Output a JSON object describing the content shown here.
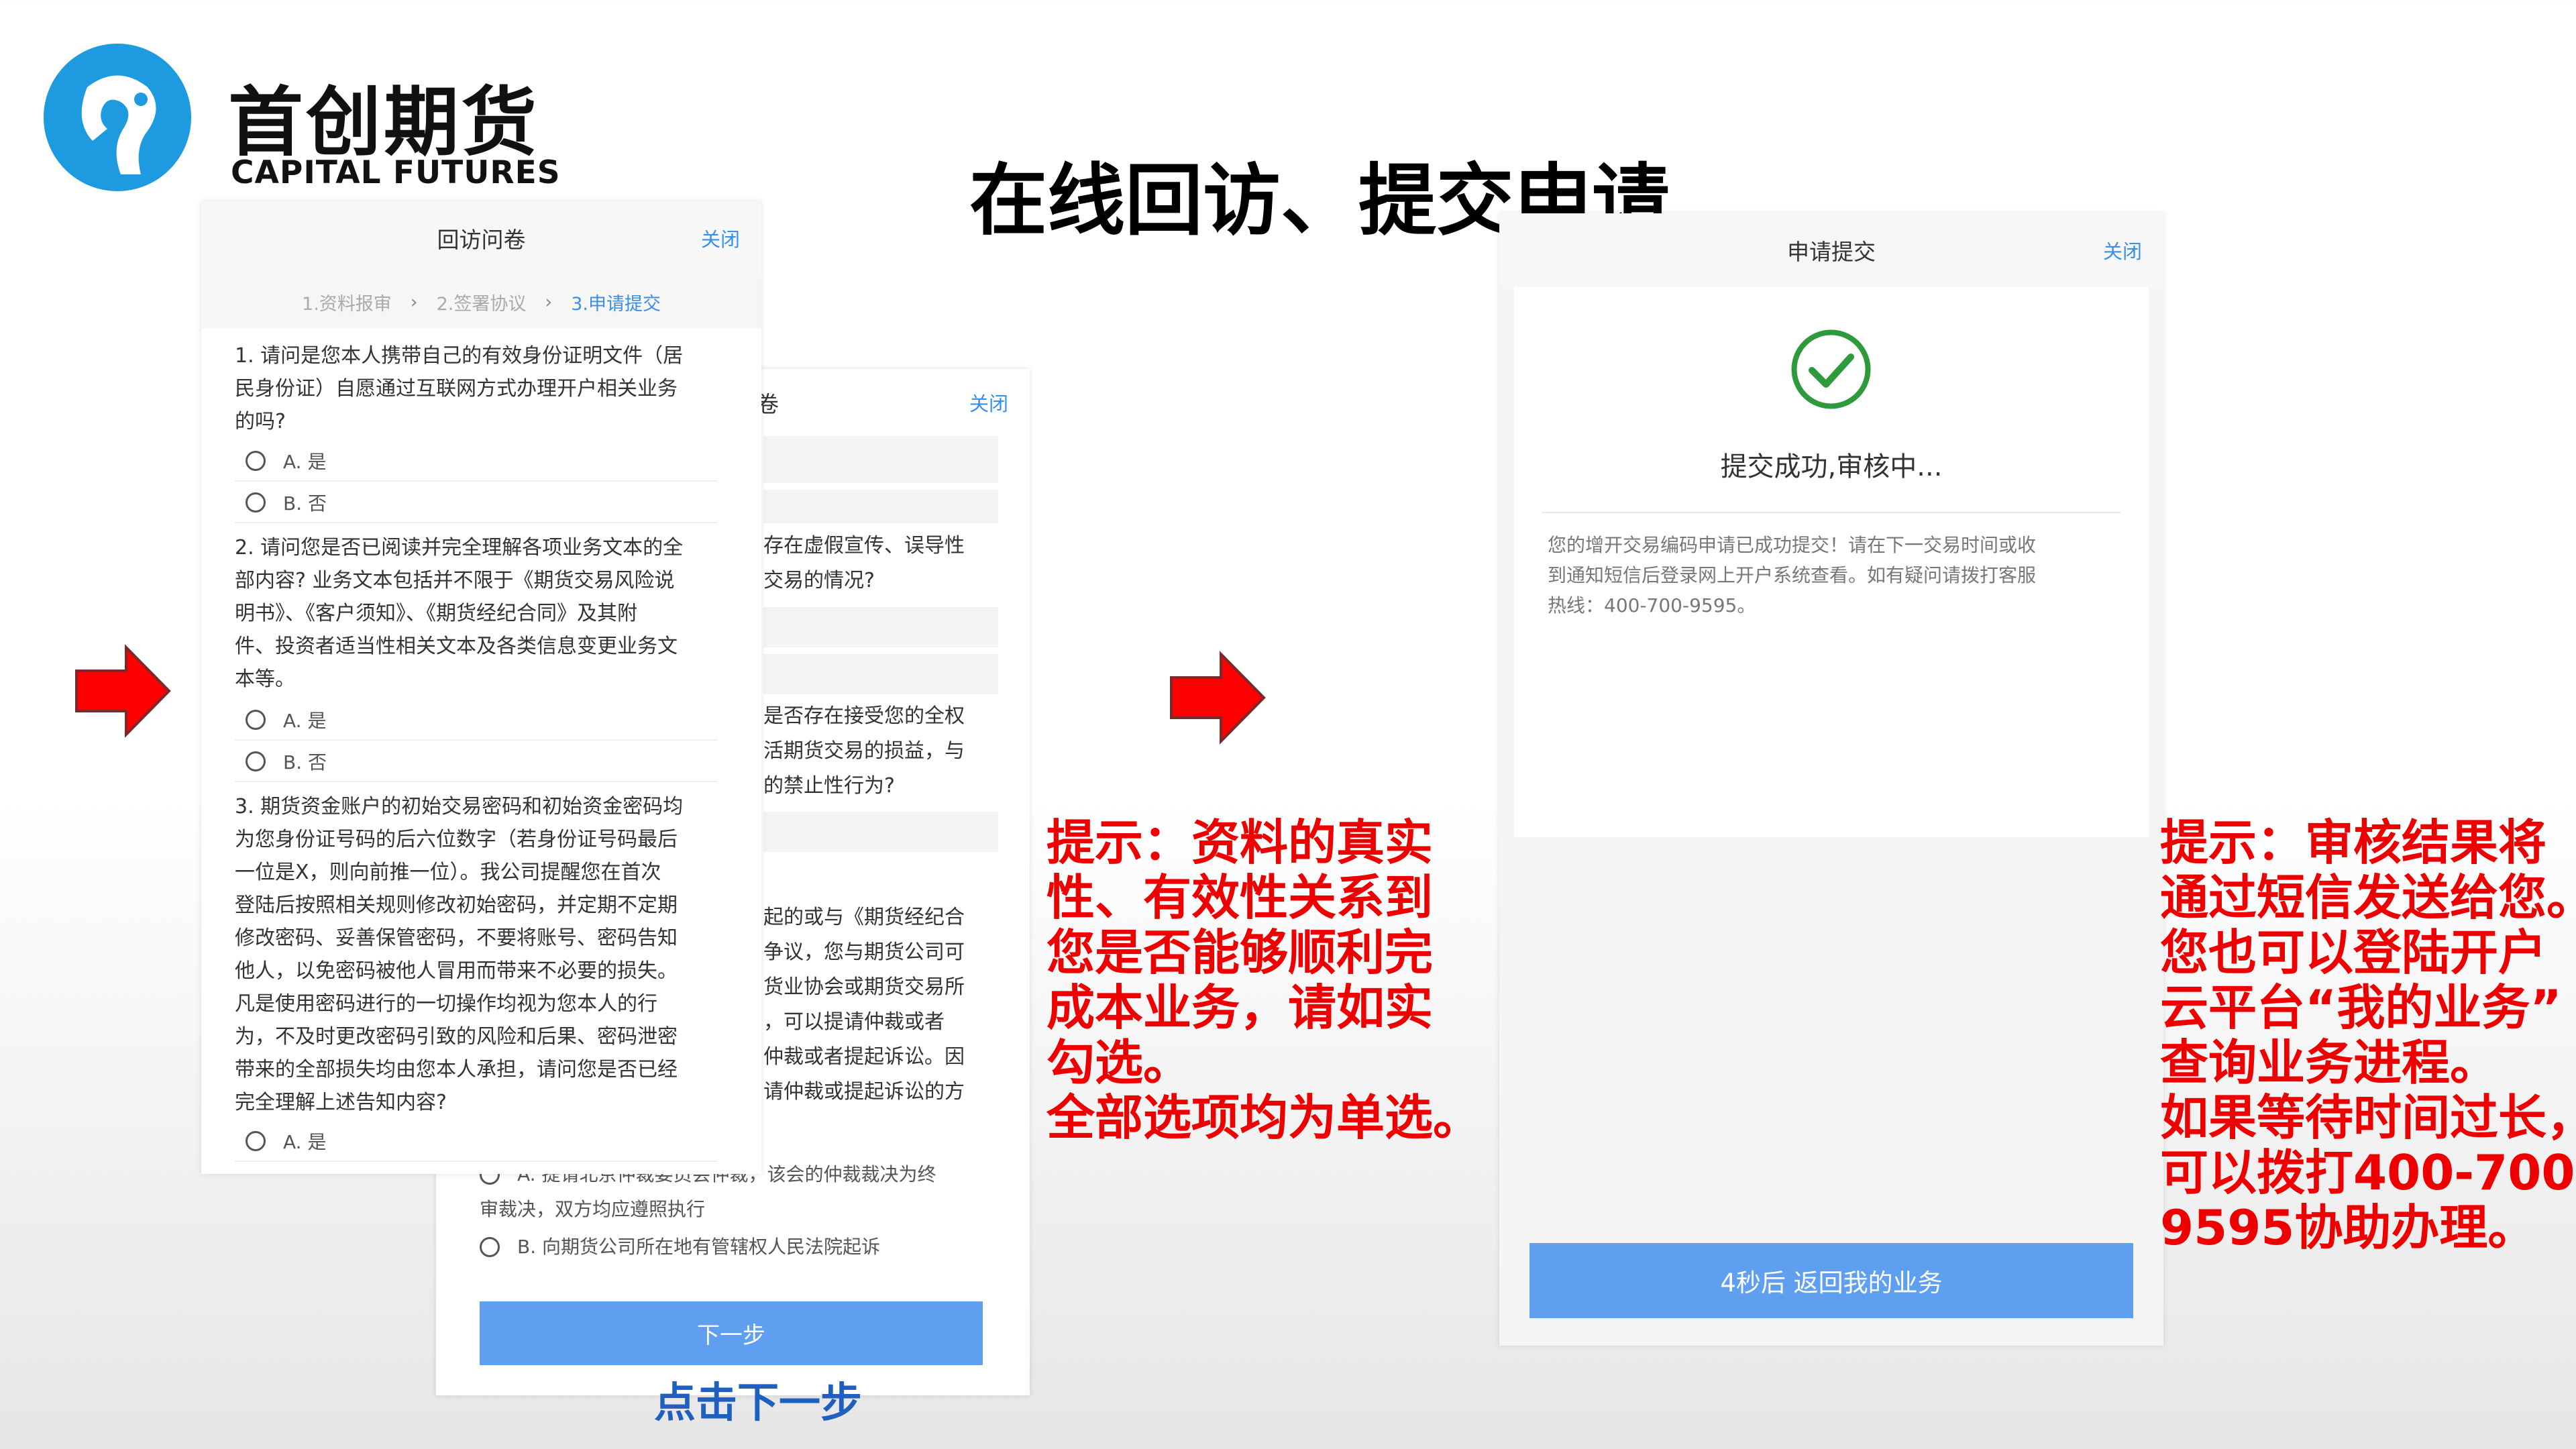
{
  "logo": {
    "cn": "首创期货",
    "en": "CAPITAL FUTURES"
  },
  "page_title": "在线回访、提交申请",
  "screen1": {
    "title": "回访问卷",
    "close": "关闭",
    "steps": [
      "1.资料报审",
      "2.签署协议",
      "3.申请提交"
    ],
    "questions": [
      {
        "lines": [
          "1. 请问是您本人携带自己的有效身份证明文件（居",
          "民身份证）自愿通过互联网方式办理开户相关业务",
          "的吗?"
        ],
        "options": [
          "A. 是",
          "B. 否"
        ]
      },
      {
        "lines": [
          "2. 请问您是否已阅读并完全理解各项业务文本的全",
          "部内容? 业务文本包括并不限于《期货交易风险说",
          "明书》、《客户须知》、《期货经纪合同》及其附",
          "件、投资者适当性相关文本及各类信息变更业务文",
          "本等。"
        ],
        "options": [
          "A. 是",
          "B. 否"
        ]
      },
      {
        "lines": [
          "3. 期货资金账户的初始交易密码和初始资金密码均",
          "为您身份证号码的后六位数字（若身份证号码最后",
          "一位是X，则向前推一位）。我公司提醒您在首次",
          "登陆后按照相关规则修改初始密码，并定期不定期",
          "修改密码、妥善保管密码，不要将账号、密码告知",
          "他人，以免密码被他人冒用而带来不必要的损失。",
          "凡是使用密码进行的一切操作均视为您本人的行",
          "为，不及时更改密码引致的风险和后果、密码泄密",
          "带来的全部损失均由您本人承担，请问您是否已经",
          "完全理解上述告知内容?"
        ],
        "options": [
          "A. 是"
        ]
      }
    ]
  },
  "screen2": {
    "title_frag": "卷",
    "close": "关闭",
    "q_frag1": [
      "存在虚假宣传、误导性",
      "交易的情况?"
    ],
    "q_frag2": [
      "是否存在接受您的全权",
      "活期货交易的损益，与",
      "的禁止性行为?"
    ],
    "q_frag3": [
      "起的或与《期货经纪合",
      "争议，您与期货公司可",
      "货业协会或期货交易所",
      "，可以提请仲裁或者",
      "仲裁或者提起诉讼。因",
      "请仲裁或提起诉讼的方"
    ],
    "opt_a": [
      "A. 提请北京仲裁委员会仲裁，该会的仲裁裁决为终",
      "审裁决，双方均应遵照执行"
    ],
    "opt_b": "B. 向期货公司所在地有管辖权人民法院起诉",
    "next_button": "下一步"
  },
  "click_next_label": "点击下一步",
  "tip1": [
    "提示：资料的真实",
    "性、有效性关系到",
    "您是否能够顺利完",
    "成本业务，请如实",
    "勾选。",
    "全部选项均为单选。"
  ],
  "screen3": {
    "title": "申请提交",
    "close": "关闭",
    "status": "提交成功,审核中...",
    "message": [
      "您的增开交易编码申请已成功提交！请在下一交易时间或收",
      "到通知短信后登录网上开户系统查看。如有疑问请拨打客服",
      "热线：400-700-9595。"
    ],
    "button": "4秒后 返回我的业务"
  },
  "tip2": [
    "提示：审核结果将",
    "通过短信发送给您。",
    "您也可以登陆开户",
    "云平台“我的业务”",
    "查询业务进程。",
    "如果等待时间过长，",
    "可以拨打400-700-",
    "9595协助办理。"
  ],
  "colors": {
    "accent_blue": "#3a8ee6",
    "button_blue": "#5f9ff0",
    "tip_red": "#ee0000",
    "success_green": "#2e9a3c",
    "label_blue": "#1f5fbf"
  }
}
